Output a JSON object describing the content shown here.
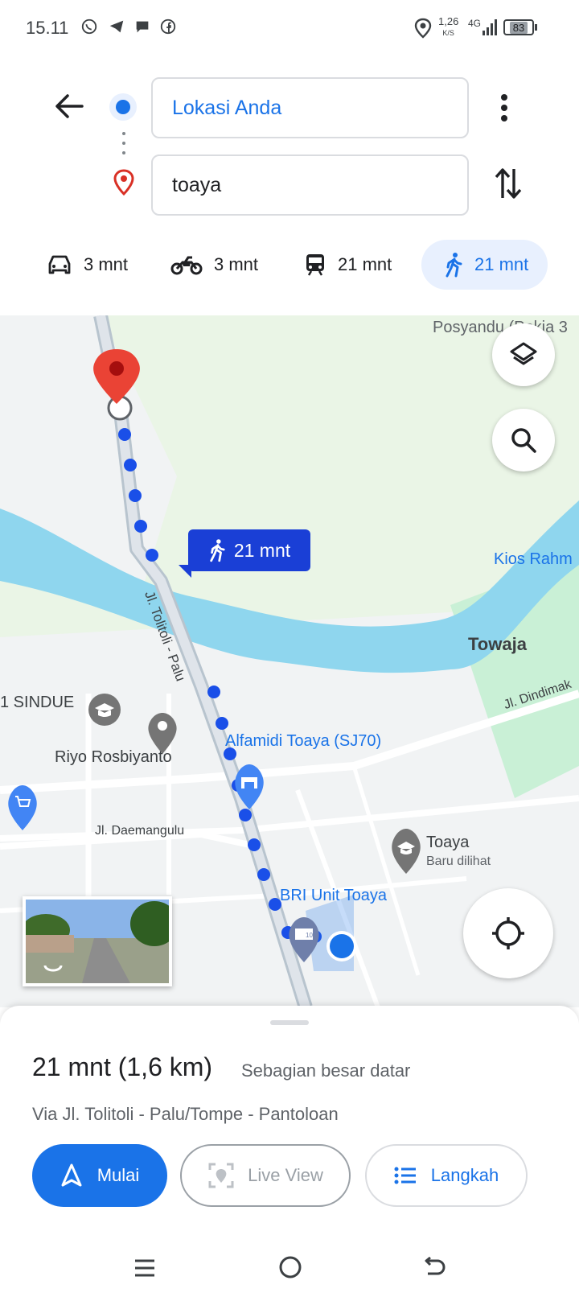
{
  "status_bar": {
    "time": "15.11",
    "speed": "1,26",
    "speed_unit": "K/S",
    "network": "4G",
    "battery": "83",
    "icons": [
      "whatsapp-icon",
      "telegram-icon",
      "chat-icon",
      "facebook-icon",
      "location-icon",
      "signal-icon",
      "battery-icon"
    ]
  },
  "directions": {
    "origin": "Lokasi Anda",
    "destination": "toaya",
    "modes": [
      {
        "name": "car",
        "label": "3 mnt"
      },
      {
        "name": "motorcycle",
        "label": "3 mnt"
      },
      {
        "name": "transit",
        "label": "21 mnt"
      },
      {
        "name": "walk",
        "label": "21 mnt",
        "active": true
      }
    ]
  },
  "map": {
    "route_badge": "21 mnt",
    "street_tolitoli": "Jl. Tolitoli - Palu",
    "street_daemangulu": "Jl. Daemangulu",
    "street_dindima": "Jl. Dindimak",
    "labels": {
      "posyandu": "Posyandu (Pokja 3",
      "kios": "Kios Rahm",
      "towaja": "Towaja",
      "sindue": "1 SINDUE",
      "riyo": "Riyo Rosbiyanto",
      "alfamidi": "Alfamidi Toaya (SJ70)",
      "toaya": "Toaya",
      "baru": "Baru dilihat",
      "bri": "BRI Unit Toaya"
    }
  },
  "sheet": {
    "duration": "21 mnt (1,6 km)",
    "note": "Sebagian besar datar",
    "via": "Via Jl. Tolitoli - Palu/Tompe - Pantoloan",
    "start_label": "Mulai",
    "liveview_label": "Live View",
    "steps_label": "Langkah"
  },
  "colors": {
    "accent": "#1a73e8",
    "route": "#1a4fe8",
    "river": "#8fd6ee",
    "park": "#c9f0d6",
    "pin": "#ea4335"
  }
}
